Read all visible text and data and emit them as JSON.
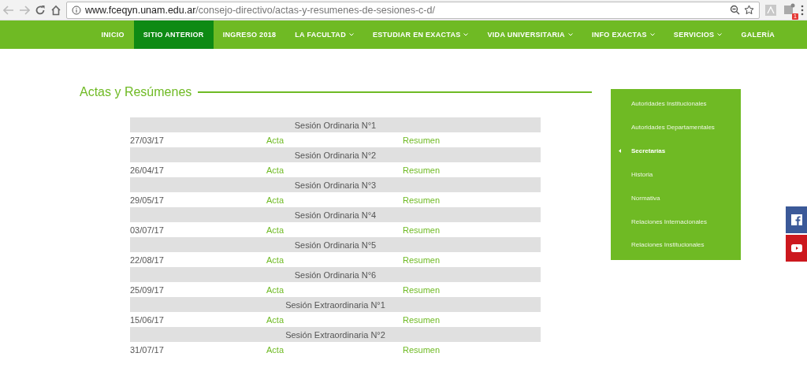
{
  "browser": {
    "url_host": "www.fceqyn.unam.edu.ar",
    "url_path": "/consejo-directivo/actas-y-resumenes-de-sesiones-c-d/",
    "extension_badge": "1"
  },
  "nav": [
    {
      "label": "INICIO",
      "selected": false,
      "dropdown": false
    },
    {
      "label": "SITIO ANTERIOR",
      "selected": true,
      "dropdown": false
    },
    {
      "label": "INGRESO 2018",
      "selected": false,
      "dropdown": false
    },
    {
      "label": "LA FACULTAD",
      "selected": false,
      "dropdown": true
    },
    {
      "label": "ESTUDIAR EN EXACTAS",
      "selected": false,
      "dropdown": true
    },
    {
      "label": "VIDA UNIVERSITARIA",
      "selected": false,
      "dropdown": true
    },
    {
      "label": "INFO EXACTAS",
      "selected": false,
      "dropdown": true
    },
    {
      "label": "SERVICIOS",
      "selected": false,
      "dropdown": true
    },
    {
      "label": "GALERÍA",
      "selected": false,
      "dropdown": false
    }
  ],
  "heading": "Actas y Resúmenes",
  "sessions": [
    {
      "title": "Sesión Ordinaria N°1",
      "date": "27/03/17",
      "acta": "Acta",
      "resumen": "Resumen"
    },
    {
      "title": "Sesión Ordinaria N°2",
      "date": "26/04/17",
      "acta": "Acta",
      "resumen": "Resumen"
    },
    {
      "title": "Sesión Ordinaria N°3",
      "date": "29/05/17",
      "acta": "Acta",
      "resumen": "Resumen"
    },
    {
      "title": "Sesión Ordinaria N°4",
      "date": "03/07/17",
      "acta": "Acta",
      "resumen": "Resumen"
    },
    {
      "title": "Sesión Ordinaria N°5",
      "date": "22/08/17",
      "acta": "Acta",
      "resumen": "Resumen"
    },
    {
      "title": "Sesión Ordinaria N°6",
      "date": "25/09/17",
      "acta": "Acta",
      "resumen": "Resumen"
    },
    {
      "title": "Sesión Extraordinaria N°1",
      "date": "15/06/17",
      "acta": "Acta",
      "resumen": "Resumen"
    },
    {
      "title": "Sesión Extraordinaria N°2",
      "date": "31/07/17",
      "acta": "Acta",
      "resumen": "Resumen"
    }
  ],
  "sidebar": [
    {
      "label": "Autoridades Institucionales",
      "selected": false
    },
    {
      "label": "Autoridades Departamentales",
      "selected": false
    },
    {
      "label": "Secretarías",
      "selected": true
    },
    {
      "label": "Historia",
      "selected": false
    },
    {
      "label": "Normativa",
      "selected": false
    },
    {
      "label": "Relaciones Internacionales",
      "selected": false
    },
    {
      "label": "Relaciones Institucionales",
      "selected": false
    }
  ]
}
